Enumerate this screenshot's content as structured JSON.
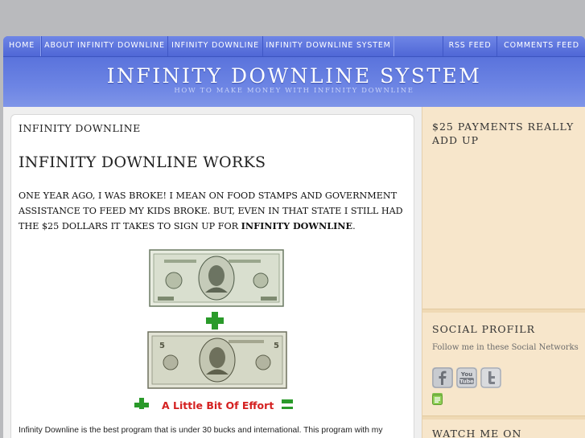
{
  "nav": {
    "items": [
      {
        "label": "HOME"
      },
      {
        "label": "ABOUT INFINITY DOWNLINE"
      },
      {
        "label": "INFINITY DOWNLINE"
      },
      {
        "label": "INFINITY DOWNLINE SYSTEM"
      }
    ],
    "feeds": [
      {
        "label": "RSS FEED"
      },
      {
        "label": "COMMENTS FEED"
      }
    ]
  },
  "header": {
    "title": "INFINITY DOWNLINE SYSTEM",
    "tagline": "HOW TO MAKE MONEY WITH INFINITY DOWNLINE"
  },
  "post": {
    "breadcrumb": "INFINITY DOWNLINE",
    "title": "INFINITY DOWNLINE WORKS",
    "paragraph_start": "ONE YEAR AGO, I WAS BROKE! I MEAN ON FOOD STAMPS AND GOVERNMENT ASSISTANCE TO FEED MY KIDS BROKE.  BUT, EVEN IN THAT STATE I STILL HAD THE $25 DOLLARS IT TAKES TO SIGN UP FOR ",
    "paragraph_bold": "INFINITY DOWNLINE",
    "paragraph_end": ".",
    "image_caption": "A Little Bit Of Effort",
    "bottom_text": "Infinity Downline is the best program that is under 30 bucks and international. This program with my"
  },
  "sidebar": {
    "widget1_title": "$25 PAYMENTS REALLY ADD UP",
    "widget2_title": "SOCIAL PROFILR",
    "widget2_text": "Follow me in these Social Networks",
    "widget3_title": "WATCH ME ON"
  },
  "icons": {
    "facebook": "facebook-icon",
    "youtube": "youtube-icon",
    "twitter": "twitter-icon",
    "small": "feed-small-icon"
  },
  "colors": {
    "accent": "#5870d8",
    "sidebar_bg": "#f7e6cb"
  }
}
